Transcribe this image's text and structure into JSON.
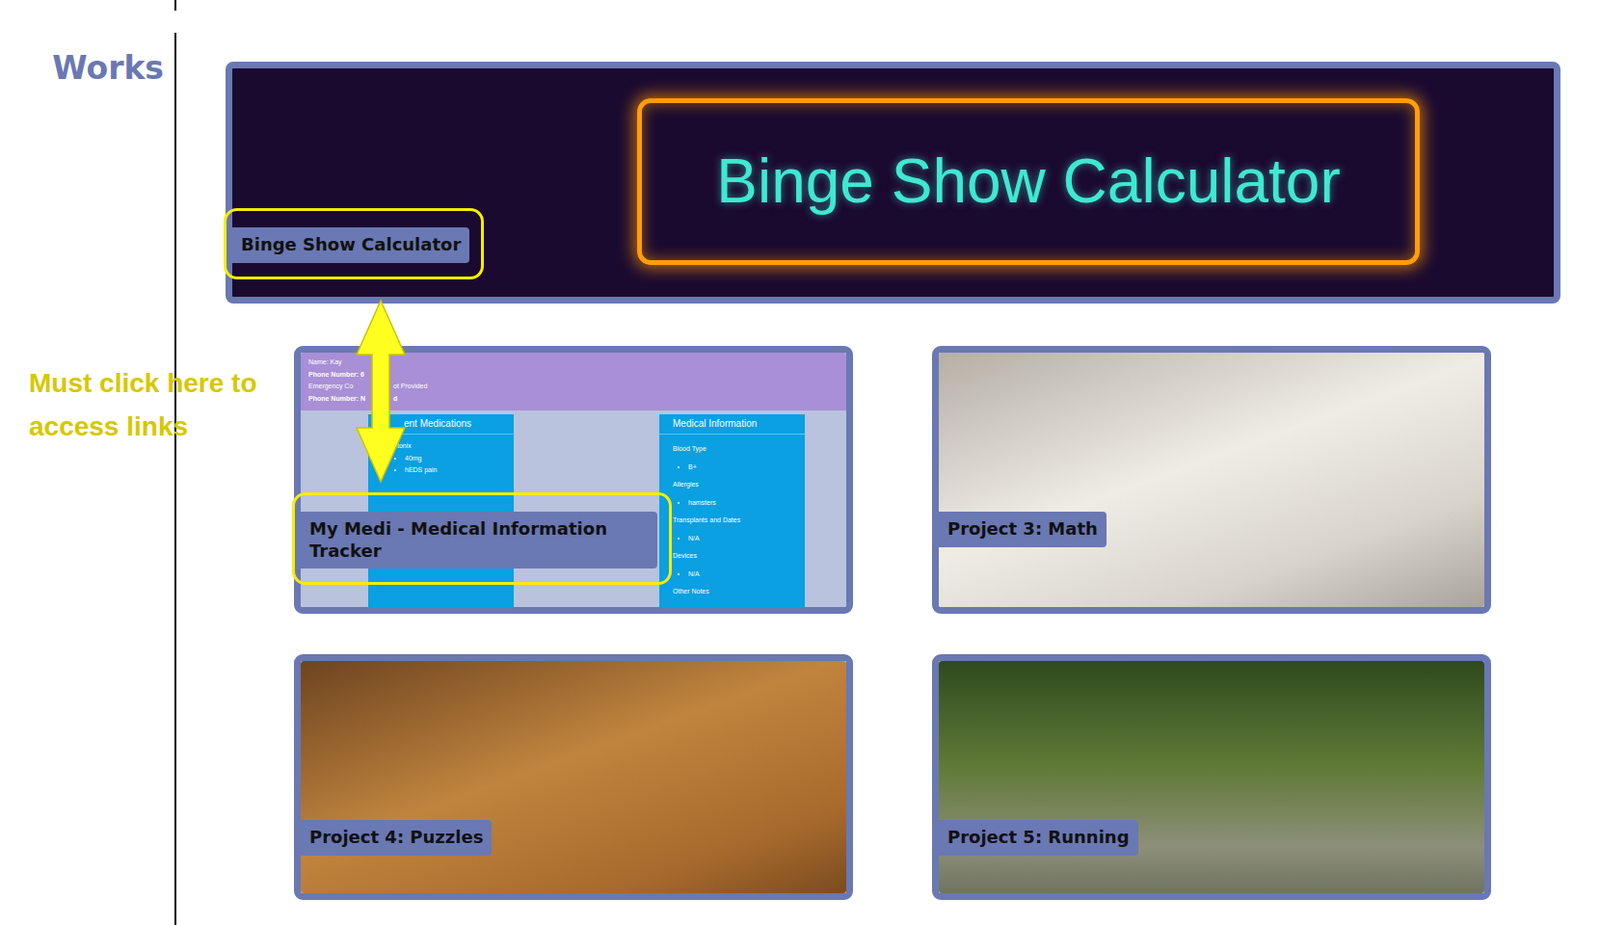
{
  "section": {
    "title": "Works"
  },
  "annotation": {
    "text": "Must click here to access links"
  },
  "featured": {
    "banner_text": "Binge Show Calculator",
    "caption": "Binge Show Calculator",
    "highlighted": true
  },
  "projects": [
    {
      "caption": "My Medi - Medical Information Tracker",
      "kind": "screenshot",
      "highlighted": true
    },
    {
      "caption": "Project 3: Math",
      "kind": "photo",
      "highlighted": false
    },
    {
      "caption": "Project 4: Puzzles",
      "kind": "photo",
      "highlighted": false
    },
    {
      "caption": "Project 5: Running",
      "kind": "photo",
      "highlighted": false
    }
  ],
  "preview": {
    "header_lines": [
      [
        "Name: Kay"
      ],
      [
        "Phone Number: 6"
      ],
      [
        "Emergency Co",
        "ot Provided"
      ],
      [
        "Phone Number: N",
        "d"
      ]
    ],
    "medications": {
      "title": "ent Medications",
      "items": [
        {
          "name": "tonix",
          "details": [
            "40mg",
            "hEDS pain"
          ]
        }
      ]
    },
    "medical_info": {
      "title": "Medical Information",
      "fields": [
        {
          "label": "Blood Type",
          "values": [
            "B+"
          ]
        },
        {
          "label": "Allergies",
          "values": [
            "hamsters"
          ]
        },
        {
          "label": "Transplants and Dates",
          "values": [
            "N/A"
          ]
        },
        {
          "label": "Devices",
          "values": [
            "N/A"
          ]
        },
        {
          "label": "Other Notes",
          "values": []
        }
      ]
    }
  }
}
